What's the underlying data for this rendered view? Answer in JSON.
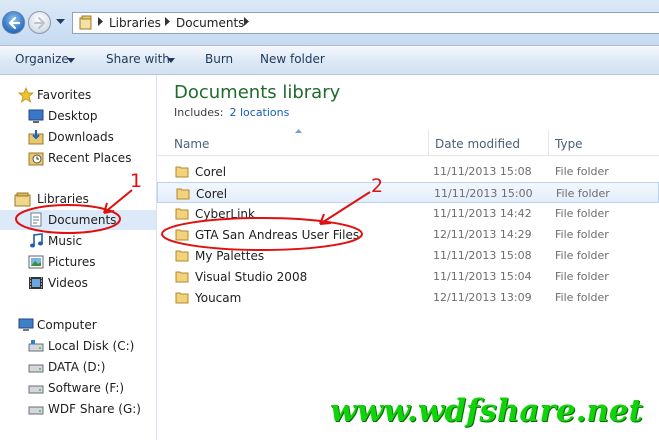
{
  "address_bar": {
    "breadcrumbs": [
      "Libraries",
      "Documents"
    ]
  },
  "toolbar": {
    "organize": "Organize",
    "share_with": "Share with",
    "burn": "Burn",
    "new_folder": "New folder"
  },
  "nav": {
    "favorites": {
      "label": "Favorites",
      "items": [
        "Desktop",
        "Downloads",
        "Recent Places"
      ]
    },
    "libraries": {
      "label": "Libraries",
      "items": [
        "Documents",
        "Music",
        "Pictures",
        "Videos"
      ]
    },
    "computer": {
      "label": "Computer",
      "items": [
        "Local Disk (C:)",
        "DATA (D:)",
        "Software (F:)",
        "WDF Share (G:)"
      ]
    }
  },
  "content": {
    "title": "Documents library",
    "includes_label": "Includes:",
    "includes_link": "2 locations",
    "columns": {
      "name": "Name",
      "date": "Date modified",
      "type": "Type"
    },
    "rows": [
      {
        "name": "Corel",
        "date": "11/11/2013 15:08",
        "type": "File folder"
      },
      {
        "name": "Corel",
        "date": "11/11/2013 15:00",
        "type": "File folder"
      },
      {
        "name": "CyberLink",
        "date": "11/11/2013 14:42",
        "type": "File folder"
      },
      {
        "name": "GTA San Andreas User Files",
        "date": "12/11/2013 14:29",
        "type": "File folder"
      },
      {
        "name": "My Palettes",
        "date": "11/11/2013 15:08",
        "type": "File folder"
      },
      {
        "name": "Visual Studio 2008",
        "date": "11/11/2013 15:04",
        "type": "File folder"
      },
      {
        "name": "Youcam",
        "date": "12/11/2013 13:09",
        "type": "File folder"
      }
    ]
  },
  "annotations": {
    "marker_1": "1",
    "marker_2": "2"
  },
  "watermark": "www.wdfshare.net",
  "colors": {
    "library_title": "#1e6b2e",
    "annotation": "#e01010",
    "watermark": "#10d40a",
    "link": "#1b5fb5"
  }
}
